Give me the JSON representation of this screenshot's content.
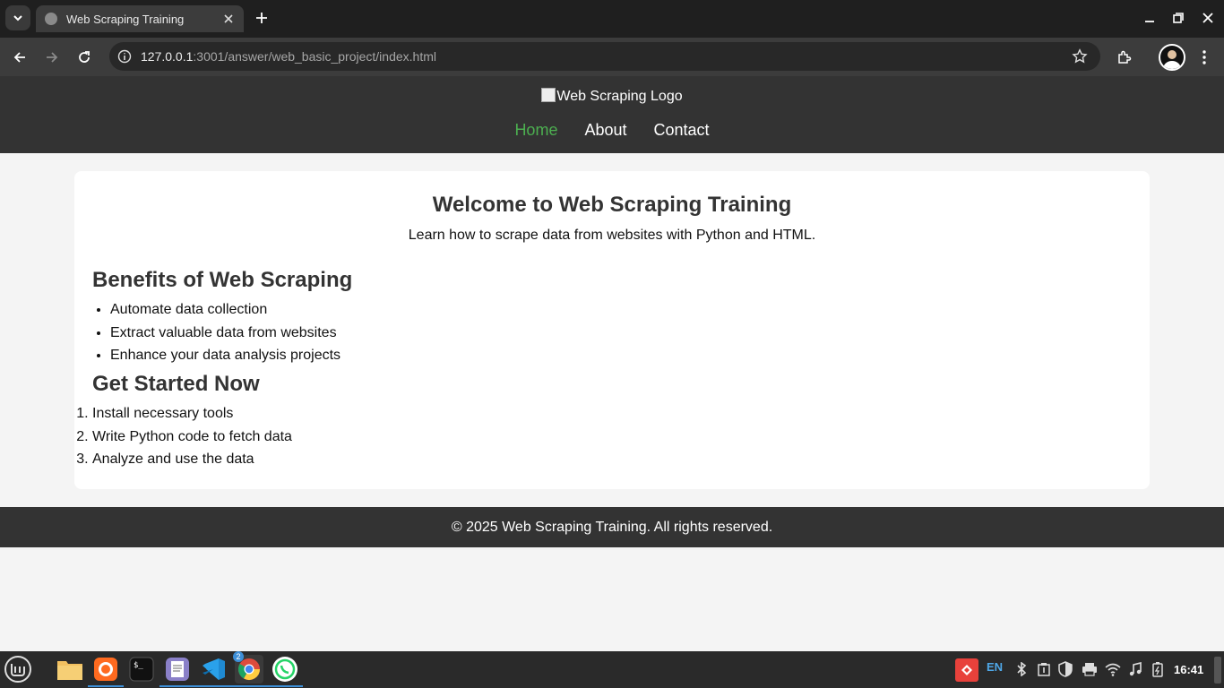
{
  "browser": {
    "tab_title": "Web Scraping Training",
    "url_host": "127.0.0.1",
    "url_path": ":3001/answer/web_basic_project/index.html"
  },
  "page": {
    "logo_alt": "Web Scraping Logo",
    "nav": [
      "Home",
      "About",
      "Contact"
    ],
    "welcome_title": "Welcome to Web Scraping Training",
    "welcome_sub": "Learn how to scrape data from websites with Python and HTML.",
    "benefits_title": "Benefits of Web Scraping",
    "benefits": [
      "Automate data collection",
      "Extract valuable data from websites",
      "Enhance your data analysis projects"
    ],
    "started_title": "Get Started Now",
    "steps": [
      "Install necessary tools",
      "Write Python code to fetch data",
      "Analyze and use the data"
    ],
    "footer": "© 2025 Web Scraping Training. All rights reserved."
  },
  "taskbar": {
    "badge": "2",
    "lang": "EN",
    "clock": "16:41"
  },
  "colors": {
    "header_bg": "#333333",
    "active_nav": "#4caf50",
    "page_bg": "#f4f4f4"
  }
}
